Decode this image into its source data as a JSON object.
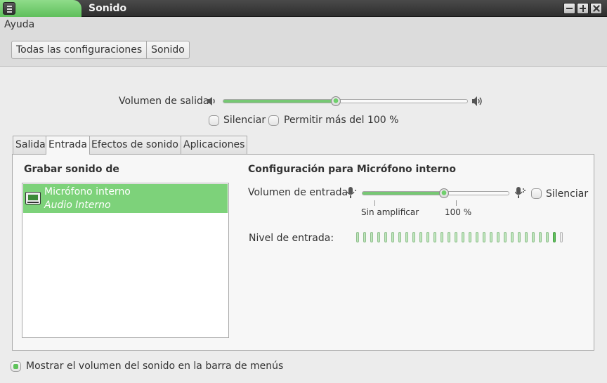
{
  "window": {
    "title": "Sonido"
  },
  "menubar": {
    "help": "Ayuda"
  },
  "breadcrumb": [
    "Todas las configuraciones",
    "Sonido"
  ],
  "output": {
    "volume_label": "Volumen de salida",
    "volume_level": 0.46,
    "mute_label": "Silenciar",
    "mute_checked": false,
    "overamp_label": "Permitir más del 100 %",
    "overamp_checked": false
  },
  "tabs": [
    {
      "label": "Salida",
      "active": false
    },
    {
      "label": "Entrada",
      "active": true
    },
    {
      "label": "Efectos de sonido",
      "active": false
    },
    {
      "label": "Aplicaciones",
      "active": false
    }
  ],
  "input": {
    "record_from_title": "Grabar sonido de",
    "devices": [
      {
        "name": "Micrófono interno",
        "description": "Audio Interno",
        "selected": true
      }
    ],
    "config_title": "Configuración para Micrófono interno",
    "volume_label": "Volumen de entrada",
    "volume_level": 0.56,
    "mute_label": "Silenciar",
    "mute_checked": false,
    "mark_unamplified": "Sin amplificar",
    "mark_100": "100 %",
    "level_label": "Nivel de entrada:",
    "level_segments": 30,
    "level_lit": 1
  },
  "footer": {
    "show_volume_label": "Mostrar el volumen del sonido en la barra de menús",
    "show_volume_checked": true
  },
  "icons": [
    "menu-icon",
    "minimize-icon",
    "maximize-icon",
    "close-icon",
    "speaker-low-icon",
    "speaker-high-icon",
    "microphone-low-icon",
    "microphone-high-icon",
    "sound-card-icon"
  ],
  "colors": {
    "accent": "#7dd27a",
    "titlebar": "#3a3a3a"
  }
}
